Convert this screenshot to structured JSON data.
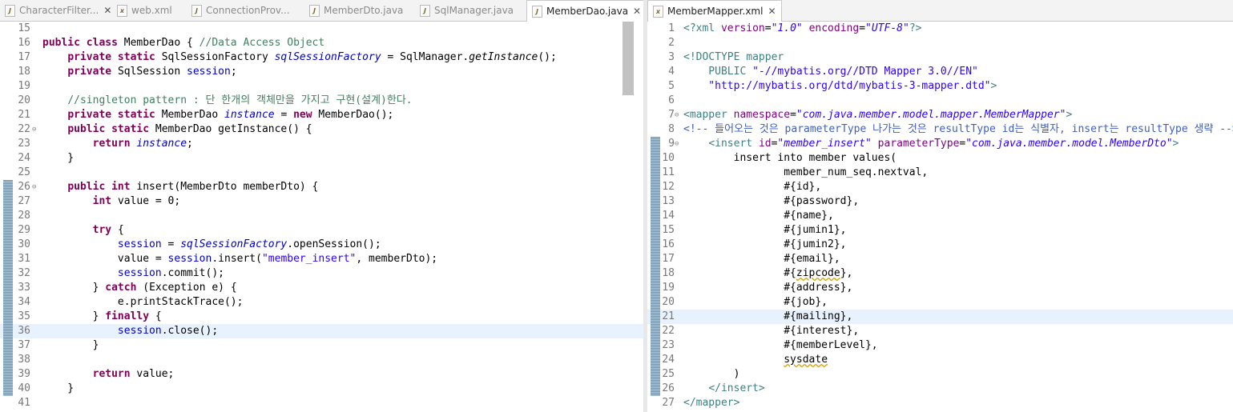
{
  "left_tabs": [
    {
      "label": "CharacterFilter...",
      "icon": "java-file-icon",
      "close": "✕"
    },
    {
      "label": "web.xml",
      "icon": "xml-file-icon"
    },
    {
      "label": "ConnectionProv...",
      "icon": "java-file-icon"
    },
    {
      "label": "MemberDto.java",
      "icon": "java-file-icon"
    },
    {
      "label": "SqlManager.java",
      "icon": "java-file-icon"
    },
    {
      "label": "MemberDao.java",
      "icon": "java-file-icon",
      "close": "✕"
    }
  ],
  "right_tabs": [
    {
      "label": "MemberMapper.xml",
      "icon": "xml-file-icon",
      "close": "✕"
    }
  ],
  "left_editor": {
    "current_line": 36,
    "lines": [
      {
        "n": "15",
        "t": []
      },
      {
        "n": "16",
        "t": [
          [
            "kw",
            "public class "
          ],
          [
            "",
            "MemberDao { "
          ],
          [
            "cm",
            "//Data Access Object"
          ]
        ]
      },
      {
        "n": "17",
        "t": [
          [
            "",
            "    "
          ],
          [
            "kw",
            "private static "
          ],
          [
            "",
            "SqlSessionFactory "
          ],
          [
            "sf",
            "sqlSessionFactory"
          ],
          [
            "",
            " = SqlManager."
          ],
          [
            "it",
            "getInstance"
          ],
          [
            "",
            "();"
          ]
        ]
      },
      {
        "n": "18",
        "t": [
          [
            "",
            "    "
          ],
          [
            "kw",
            "private "
          ],
          [
            "",
            "SqlSession "
          ],
          [
            "fl",
            "session"
          ],
          [
            "",
            ";"
          ]
        ]
      },
      {
        "n": "19",
        "t": []
      },
      {
        "n": "20",
        "t": [
          [
            "",
            "    "
          ],
          [
            "cm",
            "//singleton pattern : 단 한개의 객체만을 가지고 구현(설계)한다."
          ]
        ]
      },
      {
        "n": "21",
        "t": [
          [
            "",
            "    "
          ],
          [
            "kw",
            "private static "
          ],
          [
            "",
            "MemberDao "
          ],
          [
            "sf",
            "instance"
          ],
          [
            "",
            " = "
          ],
          [
            "kw",
            "new "
          ],
          [
            "",
            "MemberDao();"
          ]
        ]
      },
      {
        "n": "22",
        "t": [
          [
            "",
            "    "
          ],
          [
            "kw",
            "public static "
          ],
          [
            "",
            "MemberDao getInstance() {"
          ]
        ],
        "fold": "⊖"
      },
      {
        "n": "23",
        "t": [
          [
            "",
            "        "
          ],
          [
            "kw",
            "return "
          ],
          [
            "sf",
            "instance"
          ],
          [
            "",
            ";"
          ]
        ]
      },
      {
        "n": "24",
        "t": [
          [
            "",
            "    }"
          ]
        ]
      },
      {
        "n": "25",
        "t": []
      },
      {
        "n": "26",
        "t": [
          [
            "",
            "    "
          ],
          [
            "kw",
            "public int "
          ],
          [
            "",
            "insert(MemberDto memberDto) {"
          ]
        ],
        "fold": "⊖"
      },
      {
        "n": "27",
        "t": [
          [
            "",
            "        "
          ],
          [
            "kw",
            "int "
          ],
          [
            "",
            "value = 0;"
          ]
        ]
      },
      {
        "n": "28",
        "t": []
      },
      {
        "n": "29",
        "t": [
          [
            "",
            "        "
          ],
          [
            "kw",
            "try "
          ],
          [
            "",
            "{"
          ]
        ]
      },
      {
        "n": "30",
        "t": [
          [
            "",
            "            "
          ],
          [
            "fl",
            "session"
          ],
          [
            "",
            " = "
          ],
          [
            "sf",
            "sqlSessionFactory"
          ],
          [
            "",
            ".openSession();"
          ]
        ]
      },
      {
        "n": "31",
        "t": [
          [
            "",
            "            value = "
          ],
          [
            "fl",
            "session"
          ],
          [
            "",
            ".insert("
          ],
          [
            "st",
            "\"member_insert\""
          ],
          [
            "",
            ", memberDto);"
          ]
        ]
      },
      {
        "n": "32",
        "t": [
          [
            "",
            "            "
          ],
          [
            "fl",
            "session"
          ],
          [
            "",
            ".commit();"
          ]
        ]
      },
      {
        "n": "33",
        "t": [
          [
            "",
            "        } "
          ],
          [
            "kw",
            "catch "
          ],
          [
            "",
            "(Exception e) {"
          ]
        ]
      },
      {
        "n": "34",
        "t": [
          [
            "",
            "            e.printStackTrace();"
          ]
        ]
      },
      {
        "n": "35",
        "t": [
          [
            "",
            "        } "
          ],
          [
            "kw",
            "finally "
          ],
          [
            "",
            "{"
          ]
        ]
      },
      {
        "n": "36",
        "t": [
          [
            "",
            "            "
          ],
          [
            "fl",
            "session"
          ],
          [
            "",
            ".close();"
          ]
        ]
      },
      {
        "n": "37",
        "t": [
          [
            "",
            "        }"
          ]
        ]
      },
      {
        "n": "38",
        "t": []
      },
      {
        "n": "39",
        "t": [
          [
            "",
            "        "
          ],
          [
            "kw",
            "return "
          ],
          [
            "",
            "value;"
          ]
        ]
      },
      {
        "n": "40",
        "t": [
          [
            "",
            "    }"
          ]
        ]
      },
      {
        "n": "41",
        "t": []
      }
    ]
  },
  "right_editor": {
    "current_line": 21,
    "lines": [
      {
        "n": "1",
        "t": [
          [
            "x-tag",
            "<?xml "
          ],
          [
            "x-attr",
            "version"
          ],
          [
            "",
            "="
          ],
          [
            "x-val",
            "\"1.0\""
          ],
          [
            "",
            " "
          ],
          [
            "x-attr",
            "encoding"
          ],
          [
            "",
            "="
          ],
          [
            "x-val",
            "\"UTF-8\""
          ],
          [
            "x-tag",
            "?>"
          ]
        ]
      },
      {
        "n": "2",
        "t": []
      },
      {
        "n": "3",
        "t": [
          [
            "x-tag",
            "<!DOCTYPE mapper"
          ]
        ]
      },
      {
        "n": "4",
        "t": [
          [
            "x-tag",
            "    PUBLIC "
          ],
          [
            "st",
            "\"-//mybatis.org//DTD Mapper 3.0//EN\""
          ]
        ]
      },
      {
        "n": "5",
        "t": [
          [
            "st",
            "    \"http://mybatis.org/dtd/mybatis-3-mapper.dtd\""
          ],
          [
            "x-tag",
            ">"
          ]
        ]
      },
      {
        "n": "6",
        "t": []
      },
      {
        "n": "7",
        "t": [
          [
            "x-tag",
            "<mapper "
          ],
          [
            "x-attr",
            "namespace"
          ],
          [
            "",
            "="
          ],
          [
            "x-val",
            "\"com.java.member.model.mapper.MemberMapper\""
          ],
          [
            "x-tag",
            ">"
          ]
        ],
        "fold": "⊖"
      },
      {
        "n": "8",
        "t": [
          [
            "x-com",
            "<!-- 들어오는 것은 parameterType 나가는 것은 resultType id는 식별자, insert는 resultType 생략 -->"
          ]
        ]
      },
      {
        "n": "9",
        "t": [
          [
            "",
            "    "
          ],
          [
            "x-tag",
            "<insert "
          ],
          [
            "x-attr",
            "id"
          ],
          [
            "",
            "="
          ],
          [
            "x-val",
            "\"member_insert\""
          ],
          [
            "",
            " "
          ],
          [
            "x-attr",
            "parameterType"
          ],
          [
            "",
            "="
          ],
          [
            "x-val",
            "\"com.java.member.model.MemberDto\""
          ],
          [
            "x-tag",
            ">"
          ]
        ],
        "fold": "⊖"
      },
      {
        "n": "10",
        "t": [
          [
            "",
            "        insert into member values("
          ]
        ]
      },
      {
        "n": "11",
        "t": [
          [
            "",
            "                member_num_seq.nextval,"
          ]
        ]
      },
      {
        "n": "12",
        "t": [
          [
            "",
            "                #{id},"
          ]
        ]
      },
      {
        "n": "13",
        "t": [
          [
            "",
            "                #{password},"
          ]
        ]
      },
      {
        "n": "14",
        "t": [
          [
            "",
            "                #{name},"
          ]
        ]
      },
      {
        "n": "15",
        "t": [
          [
            "",
            "                #{jumin1},"
          ]
        ]
      },
      {
        "n": "16",
        "t": [
          [
            "",
            "                #{jumin2},"
          ]
        ]
      },
      {
        "n": "17",
        "t": [
          [
            "",
            "                #{email},"
          ]
        ]
      },
      {
        "n": "18",
        "t": [
          [
            "",
            "                #{"
          ],
          [
            "sq",
            "zipcode"
          ],
          [
            "",
            "},"
          ]
        ]
      },
      {
        "n": "19",
        "t": [
          [
            "",
            "                #{address},"
          ]
        ]
      },
      {
        "n": "20",
        "t": [
          [
            "",
            "                #{job},"
          ]
        ]
      },
      {
        "n": "21",
        "t": [
          [
            "",
            "                #{mailing},"
          ]
        ]
      },
      {
        "n": "22",
        "t": [
          [
            "",
            "                #{interest},"
          ]
        ]
      },
      {
        "n": "23",
        "t": [
          [
            "",
            "                #{memberLevel},"
          ]
        ]
      },
      {
        "n": "24",
        "t": [
          [
            "",
            "                "
          ],
          [
            "sq",
            "sysdate"
          ]
        ]
      },
      {
        "n": "25",
        "t": [
          [
            "",
            "        )"
          ]
        ]
      },
      {
        "n": "26",
        "t": [
          [
            "",
            "    "
          ],
          [
            "x-tag",
            "</insert>"
          ]
        ]
      },
      {
        "n": "27",
        "t": [
          [
            "x-tag",
            "</mapper>"
          ]
        ]
      }
    ]
  }
}
